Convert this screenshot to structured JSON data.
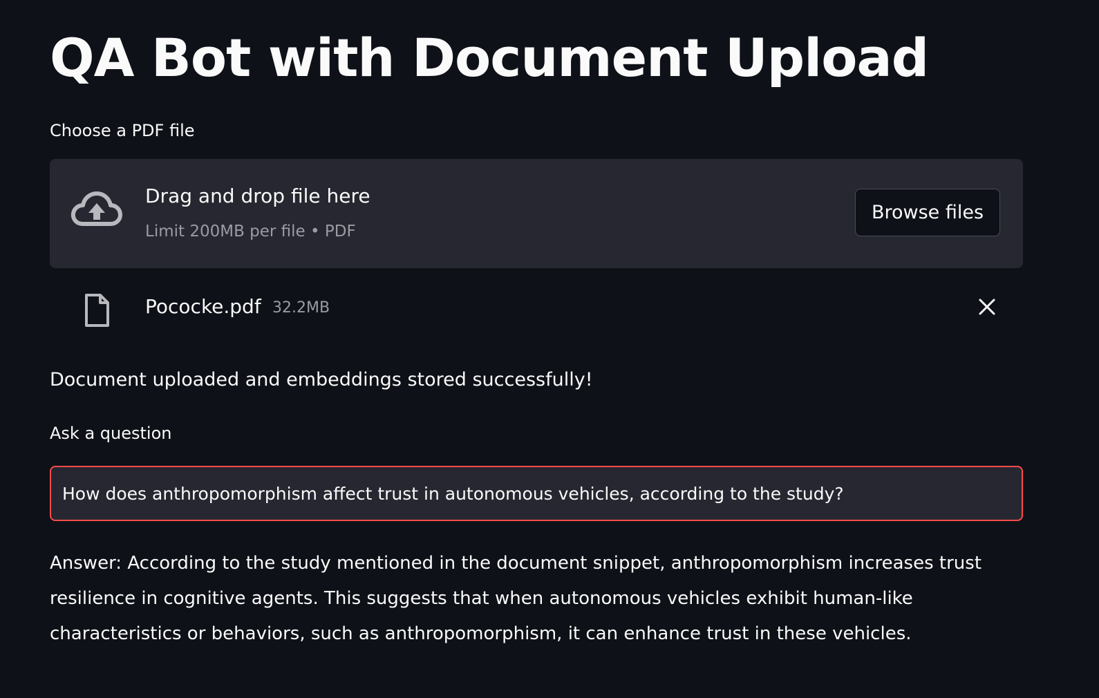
{
  "page": {
    "title": "QA Bot with Document Upload"
  },
  "uploader": {
    "label": "Choose a PDF file",
    "drop_title": "Drag and drop file here",
    "drop_limit": "Limit 200MB per file • PDF",
    "browse_label": "Browse files",
    "icon": "cloud-upload-icon"
  },
  "uploaded_file": {
    "name": "Pococke.pdf",
    "size": "32.2MB",
    "icon": "file-icon",
    "remove_icon": "close-icon"
  },
  "status": {
    "message": "Document uploaded and embeddings stored successfully!"
  },
  "question": {
    "label": "Ask a question",
    "value": "How does anthropomorphism affect trust in autonomous vehicles, according to the study?"
  },
  "answer": {
    "text": "Answer: According to the study mentioned in the document snippet, anthropomorphism increases trust resilience in cognitive agents. This suggests that when autonomous vehicles exhibit human-like characteristics or behaviors, such as anthropomorphism, it can enhance trust in these vehicles."
  },
  "colors": {
    "background": "#0e1117",
    "panel": "#262730",
    "focus_border": "#ff4b4b",
    "muted_text": "#9a9ba3"
  }
}
